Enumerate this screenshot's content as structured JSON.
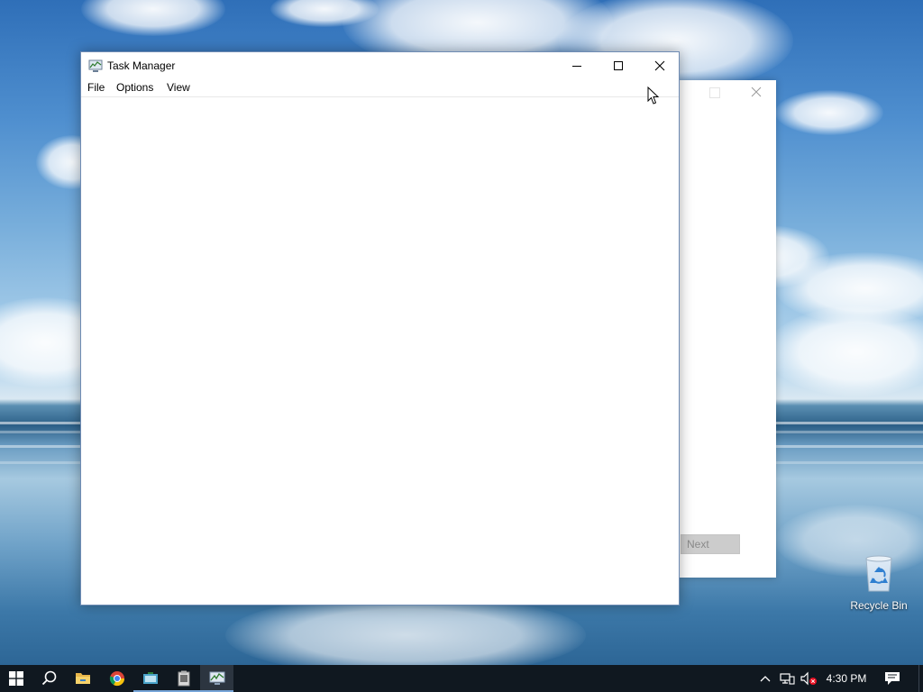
{
  "desktop": {
    "recycle_bin_label": "Recycle Bin"
  },
  "background_dialog": {
    "next_label": "Next"
  },
  "task_manager": {
    "title": "Task Manager",
    "menu": {
      "file": "File",
      "options": "Options",
      "view": "View"
    }
  },
  "taskbar": {
    "items": [
      {
        "name": "start",
        "icon": "windows-logo-icon"
      },
      {
        "name": "search",
        "icon": "search-icon"
      },
      {
        "name": "file-explorer",
        "icon": "folder-icon"
      },
      {
        "name": "chrome",
        "icon": "chrome-icon"
      },
      {
        "name": "app",
        "icon": "app-icon"
      },
      {
        "name": "app",
        "icon": "app-icon"
      },
      {
        "name": "task-manager",
        "icon": "task-manager-icon",
        "active": true
      }
    ],
    "clock": "4:30 PM"
  },
  "colors": {
    "taskbar": "#101820",
    "active_underline": "#77a6d9",
    "window_border": "#6f8cb4"
  }
}
